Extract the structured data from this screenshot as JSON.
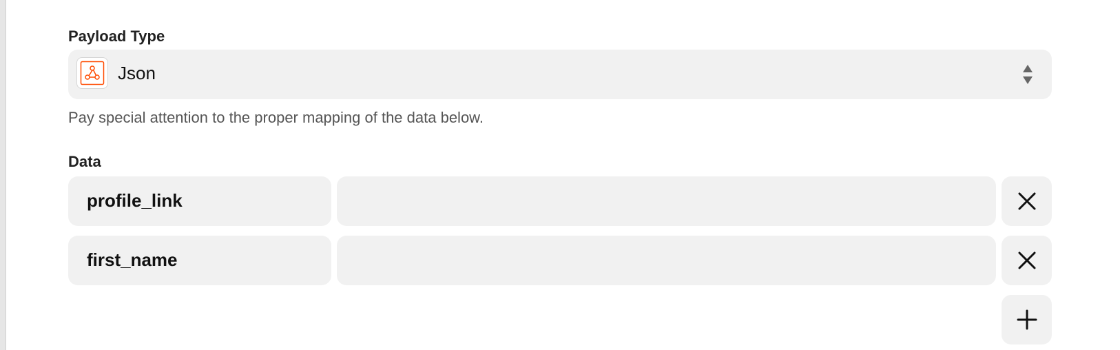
{
  "payload_type": {
    "label": "Payload Type",
    "selected_value": "Json",
    "help_text": "Pay special attention to the proper mapping of the data below.",
    "option_icon": "webhook-icon",
    "icon_color": "#ff4a00"
  },
  "data_section": {
    "label": "Data",
    "rows": [
      {
        "key": "profile_link",
        "value": ""
      },
      {
        "key": "first_name",
        "value": ""
      }
    ],
    "remove_icon": "close-icon",
    "add_icon": "plus-icon"
  }
}
